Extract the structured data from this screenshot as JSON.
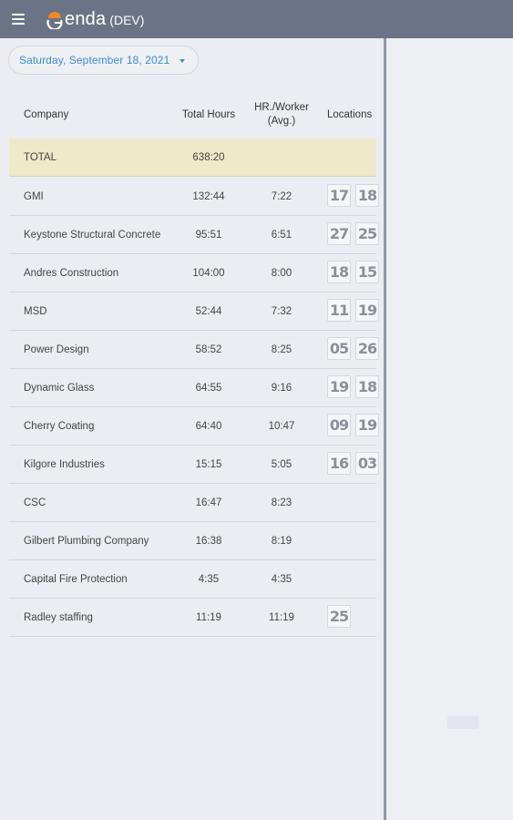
{
  "app": {
    "name": "enda",
    "environment": "(DEV)"
  },
  "date_picker": {
    "value": "Saturday,  September 18,  2021"
  },
  "table": {
    "headers": {
      "company": "Company",
      "total_hours": "Total Hours",
      "hr_worker_line1": "HR./Worker",
      "hr_worker_line2": "(Avg.)",
      "locations": "Locations"
    },
    "total": {
      "company": "TOTAL",
      "total_hours": "638:20",
      "hr_worker": ""
    },
    "rows": [
      {
        "company": "GMI",
        "total_hours": "132:44",
        "hr_worker": "7:22",
        "locations": [
          "17",
          "18"
        ]
      },
      {
        "company": "Keystone Structural Concrete",
        "total_hours": "95:51",
        "hr_worker": "6:51",
        "locations": [
          "27",
          "25"
        ]
      },
      {
        "company": "Andres Construction",
        "total_hours": "104:00",
        "hr_worker": "8:00",
        "locations": [
          "18",
          "15"
        ]
      },
      {
        "company": "MSD",
        "total_hours": "52:44",
        "hr_worker": "7:32",
        "locations": [
          "11",
          "19"
        ]
      },
      {
        "company": "Power Design",
        "total_hours": "58:52",
        "hr_worker": "8:25",
        "locations": [
          "05",
          "26"
        ]
      },
      {
        "company": "Dynamic Glass",
        "total_hours": "64:55",
        "hr_worker": "9:16",
        "locations": [
          "19",
          "18"
        ]
      },
      {
        "company": "Cherry Coating",
        "total_hours": "64:40",
        "hr_worker": "10:47",
        "locations": [
          "09",
          "19"
        ]
      },
      {
        "company": "Kilgore Industries",
        "total_hours": "15:15",
        "hr_worker": "5:05",
        "locations": [
          "16",
          "03"
        ]
      },
      {
        "company": "CSC",
        "total_hours": "16:47",
        "hr_worker": "8:23",
        "locations": []
      },
      {
        "company": "Gilbert Plumbing Company",
        "total_hours": "16:38",
        "hr_worker": "8:19",
        "locations": []
      },
      {
        "company": "Capital Fire Protection",
        "total_hours": "4:35",
        "hr_worker": "4:35",
        "locations": []
      },
      {
        "company": "Radley staffing",
        "total_hours": "11:19",
        "hr_worker": "11:19",
        "locations": [
          "25"
        ]
      }
    ]
  },
  "icons": {
    "menu": "hamburger-menu-icon",
    "logo": "logo-icon",
    "dropdown": "chevron-down-icon"
  },
  "colors": {
    "header_bg": "#6b7486",
    "accent": "#3c8dd6",
    "total_row_bg": "#ede9c9",
    "logo_orange": "#ef8a1f"
  }
}
